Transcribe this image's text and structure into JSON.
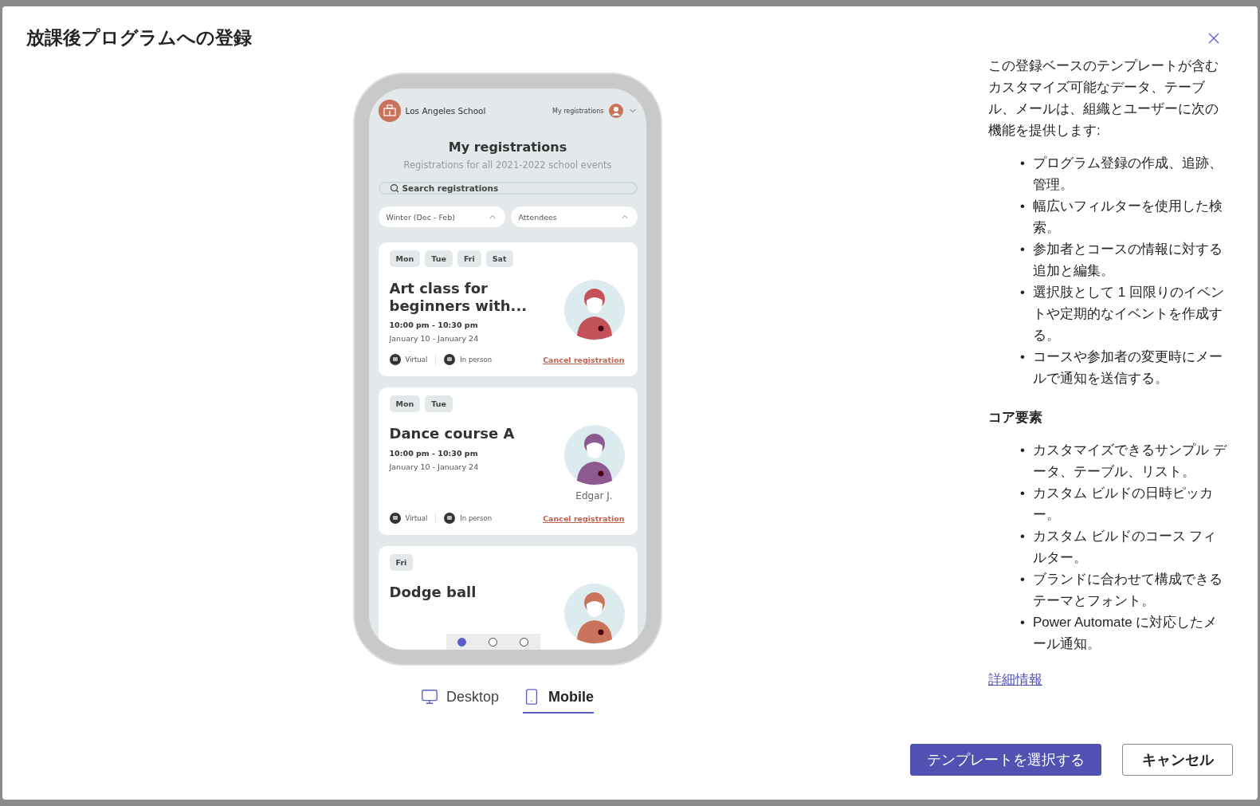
{
  "dialog": {
    "title": "放課後プログラムへの登録"
  },
  "preview": {
    "app": {
      "school": "Los Angeles School",
      "nav_link": "My registrations",
      "heading": "My registrations",
      "subheading": "Registrations for all 2021-2022 school events",
      "search": {
        "placeholder": "Search registrations"
      },
      "filters": [
        "Winter (Dec - Feb)",
        "Attendees"
      ],
      "cards": [
        {
          "days": [
            "Mon",
            "Tue",
            "Fri",
            "Sat"
          ],
          "title": "Art class for beginners with...",
          "time": "10:00 pm - 10:30 pm",
          "dates": "January 10 - January 24",
          "color": "#c4525a",
          "modes": [
            "Virtual",
            "In person"
          ],
          "action": "Cancel registration"
        },
        {
          "days": [
            "Mon",
            "Tue"
          ],
          "title": "Dance course A",
          "time": "10:00 pm - 10:30 pm",
          "dates": "January 10 - January 24",
          "color": "#8c5a90",
          "attendee": "Edgar J.",
          "modes": [
            "Virtual",
            "In person"
          ],
          "action": "Cancel registration"
        },
        {
          "days": [
            "Fri"
          ],
          "title": "Dodge ball",
          "color": "#c8735a"
        }
      ]
    },
    "pager": [
      {
        "selected": true
      },
      {
        "selected": false
      },
      {
        "selected": false
      }
    ]
  },
  "view_tabs": [
    {
      "kind": "desktop",
      "label": "Desktop",
      "selected": false
    },
    {
      "kind": "mobile",
      "label": "Mobile",
      "selected": true
    }
  ],
  "description": {
    "bullet": "•",
    "intro": "この登録ベースのテンプレートが含むカスタマイズ可能なデータ、テーブル、メールは、組織とユーザーに次の機能を提供します:",
    "features": [
      "プログラム登録の作成、追跡、管理。",
      "幅広いフィルターを使用した検索。",
      "参加者とコースの情報に対する追加と編集。",
      "選択肢として 1 回限りのイベントや定期的なイベントを作成する。",
      "コースや参加者の変更時にメールで通知を送信する。"
    ],
    "core_heading": "コア要素",
    "core_items": [
      "カスタマイズできるサンプル データ、テーブル、リスト。",
      "カスタム ビルドの日時ピッカー。",
      "カスタム ビルドのコース フィルター。",
      "ブランドに合わせて構成できるテーマとフォント。",
      "Power Automate に対応したメール通知。"
    ],
    "link": "詳細情報"
  },
  "buttons": [
    {
      "kind": "primary",
      "label": "テンプレートを選択する"
    },
    {
      "kind": "secondary",
      "label": "キャンセル"
    }
  ]
}
